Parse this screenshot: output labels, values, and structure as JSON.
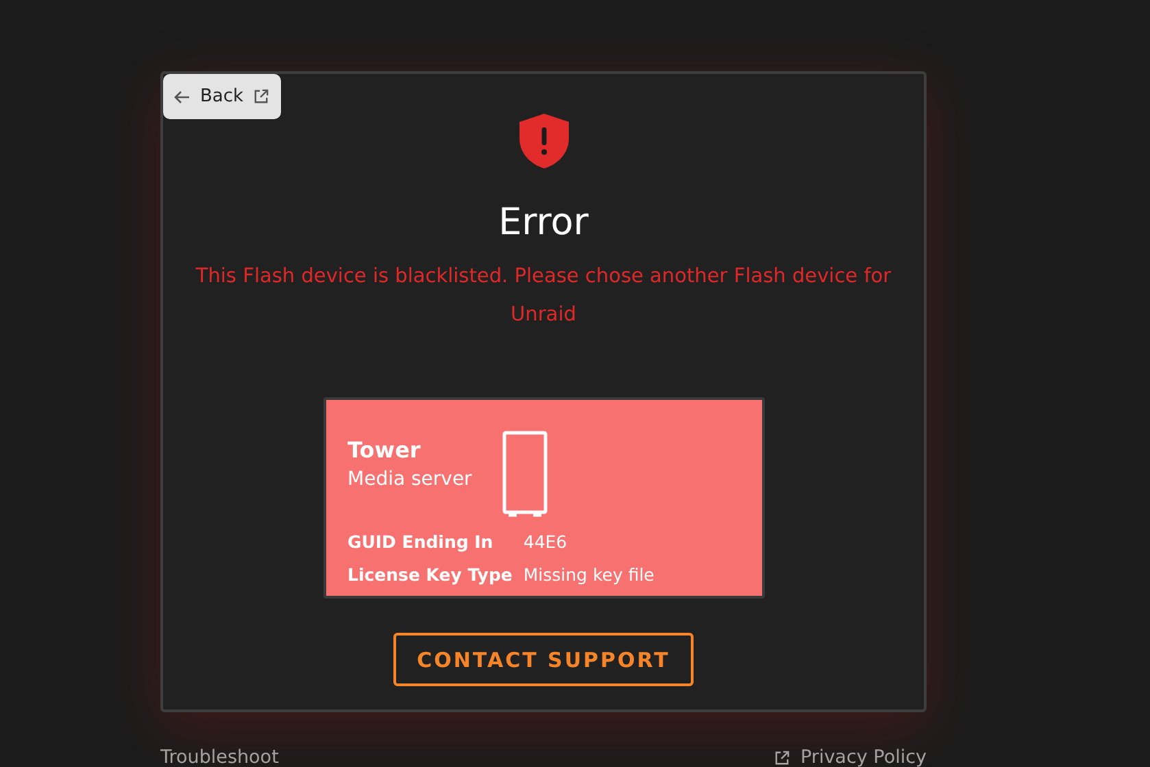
{
  "back_button": {
    "label": "Back"
  },
  "error": {
    "title": "Error",
    "message": "This Flash device is blacklisted. Please chose another Flash device for Unraid"
  },
  "server": {
    "name": "Tower",
    "description": "Media server",
    "details": [
      {
        "label": "GUID Ending In",
        "value": "44E6"
      },
      {
        "label": "License Key Type",
        "value": "Missing key file"
      }
    ]
  },
  "contact_button": {
    "label": "CONTACT SUPPORT"
  },
  "footer": {
    "links": [
      {
        "label": "Troubleshoot",
        "external": false
      },
      {
        "label": "Privacy Policy",
        "external": true
      }
    ]
  }
}
